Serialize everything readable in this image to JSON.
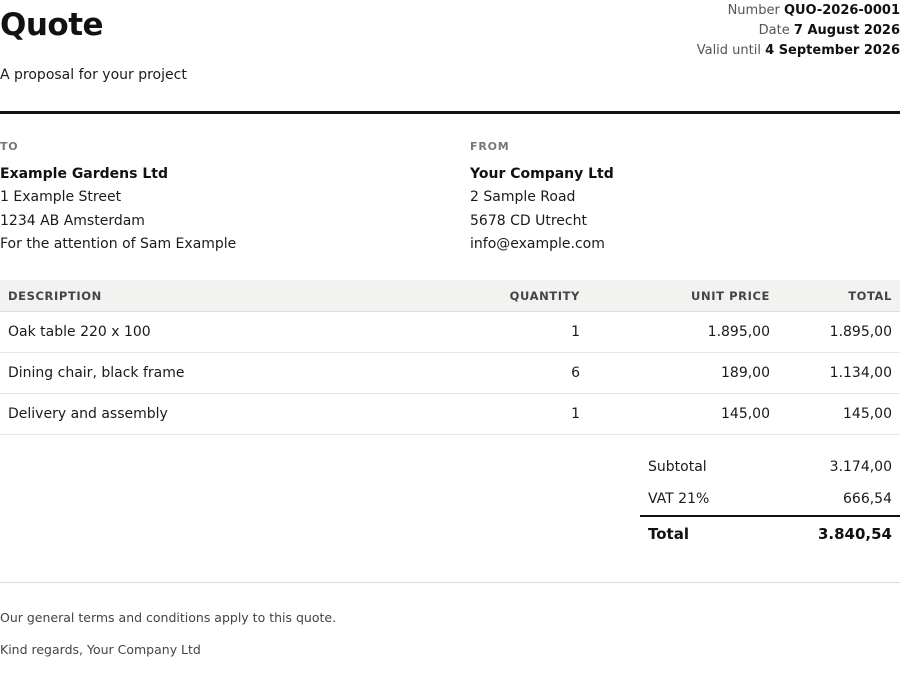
{
  "header": {
    "title": "Quote",
    "subtitle": "A proposal for your project",
    "meta": [
      {
        "label": "Number",
        "value": "QUO-2026-0001"
      },
      {
        "label": "Date",
        "value": "7 August 2026"
      },
      {
        "label": "Valid until",
        "value": "4 September 2026"
      }
    ]
  },
  "to": {
    "heading": "TO",
    "name": "Example Gardens Ltd",
    "lines": [
      "1 Example Street",
      "1234 AB Amsterdam",
      "For the attention of Sam Example"
    ]
  },
  "from": {
    "heading": "FROM",
    "name": "Your Company Ltd",
    "lines": [
      "2 Sample Road",
      "5678 CD Utrecht",
      "info@example.com"
    ]
  },
  "table": {
    "headers": {
      "description": "DESCRIPTION",
      "quantity": "QUANTITY",
      "unit_price": "UNIT PRICE",
      "total": "TOTAL"
    },
    "rows": [
      {
        "description": "Oak table 220 x 100",
        "quantity": "1",
        "unit_price": "1.895,00",
        "total": "1.895,00"
      },
      {
        "description": "Dining chair, black frame",
        "quantity": "6",
        "unit_price": "189,00",
        "total": "1.134,00"
      },
      {
        "description": "Delivery and assembly",
        "quantity": "1",
        "unit_price": "145,00",
        "total": "145,00"
      }
    ]
  },
  "totals": {
    "subtotal_label": "Subtotal",
    "subtotal_value": "3.174,00",
    "vat_label": "VAT 21%",
    "vat_value": "666,54",
    "total_label": "Total",
    "total_value": "3.840,54"
  },
  "footer": {
    "terms": "Our general terms and conditions apply to this quote.",
    "regards": "Kind regards, Your Company Ltd"
  }
}
